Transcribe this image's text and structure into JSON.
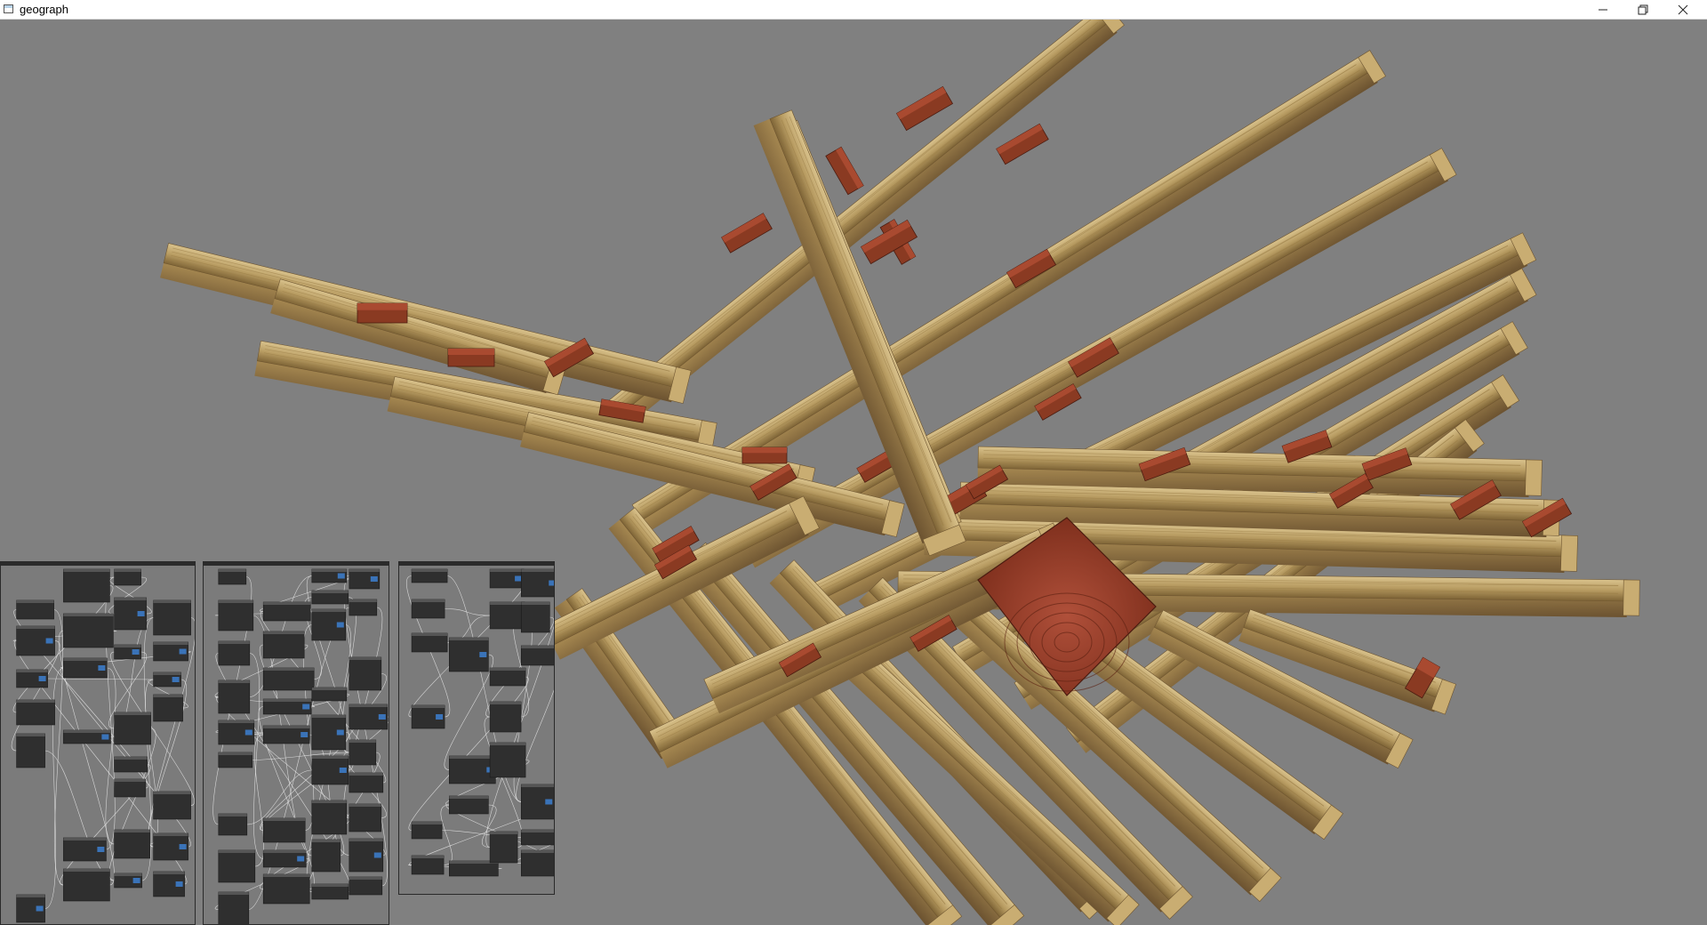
{
  "window": {
    "title": "geograph",
    "minimize_icon": "minimize-icon",
    "restore_icon": "restore-icon",
    "close_icon": "close-icon"
  },
  "viewport": {
    "scene": "3d-timber-joinery-structure",
    "background_color": "#808080",
    "wood_color": "#b89c62",
    "wedge_color": "#8a3a22"
  },
  "node_panels": {
    "count": 3,
    "node_color": "#2f2f2f",
    "port_color": "#3a73b8",
    "wire_color": "#e8e8e8"
  }
}
